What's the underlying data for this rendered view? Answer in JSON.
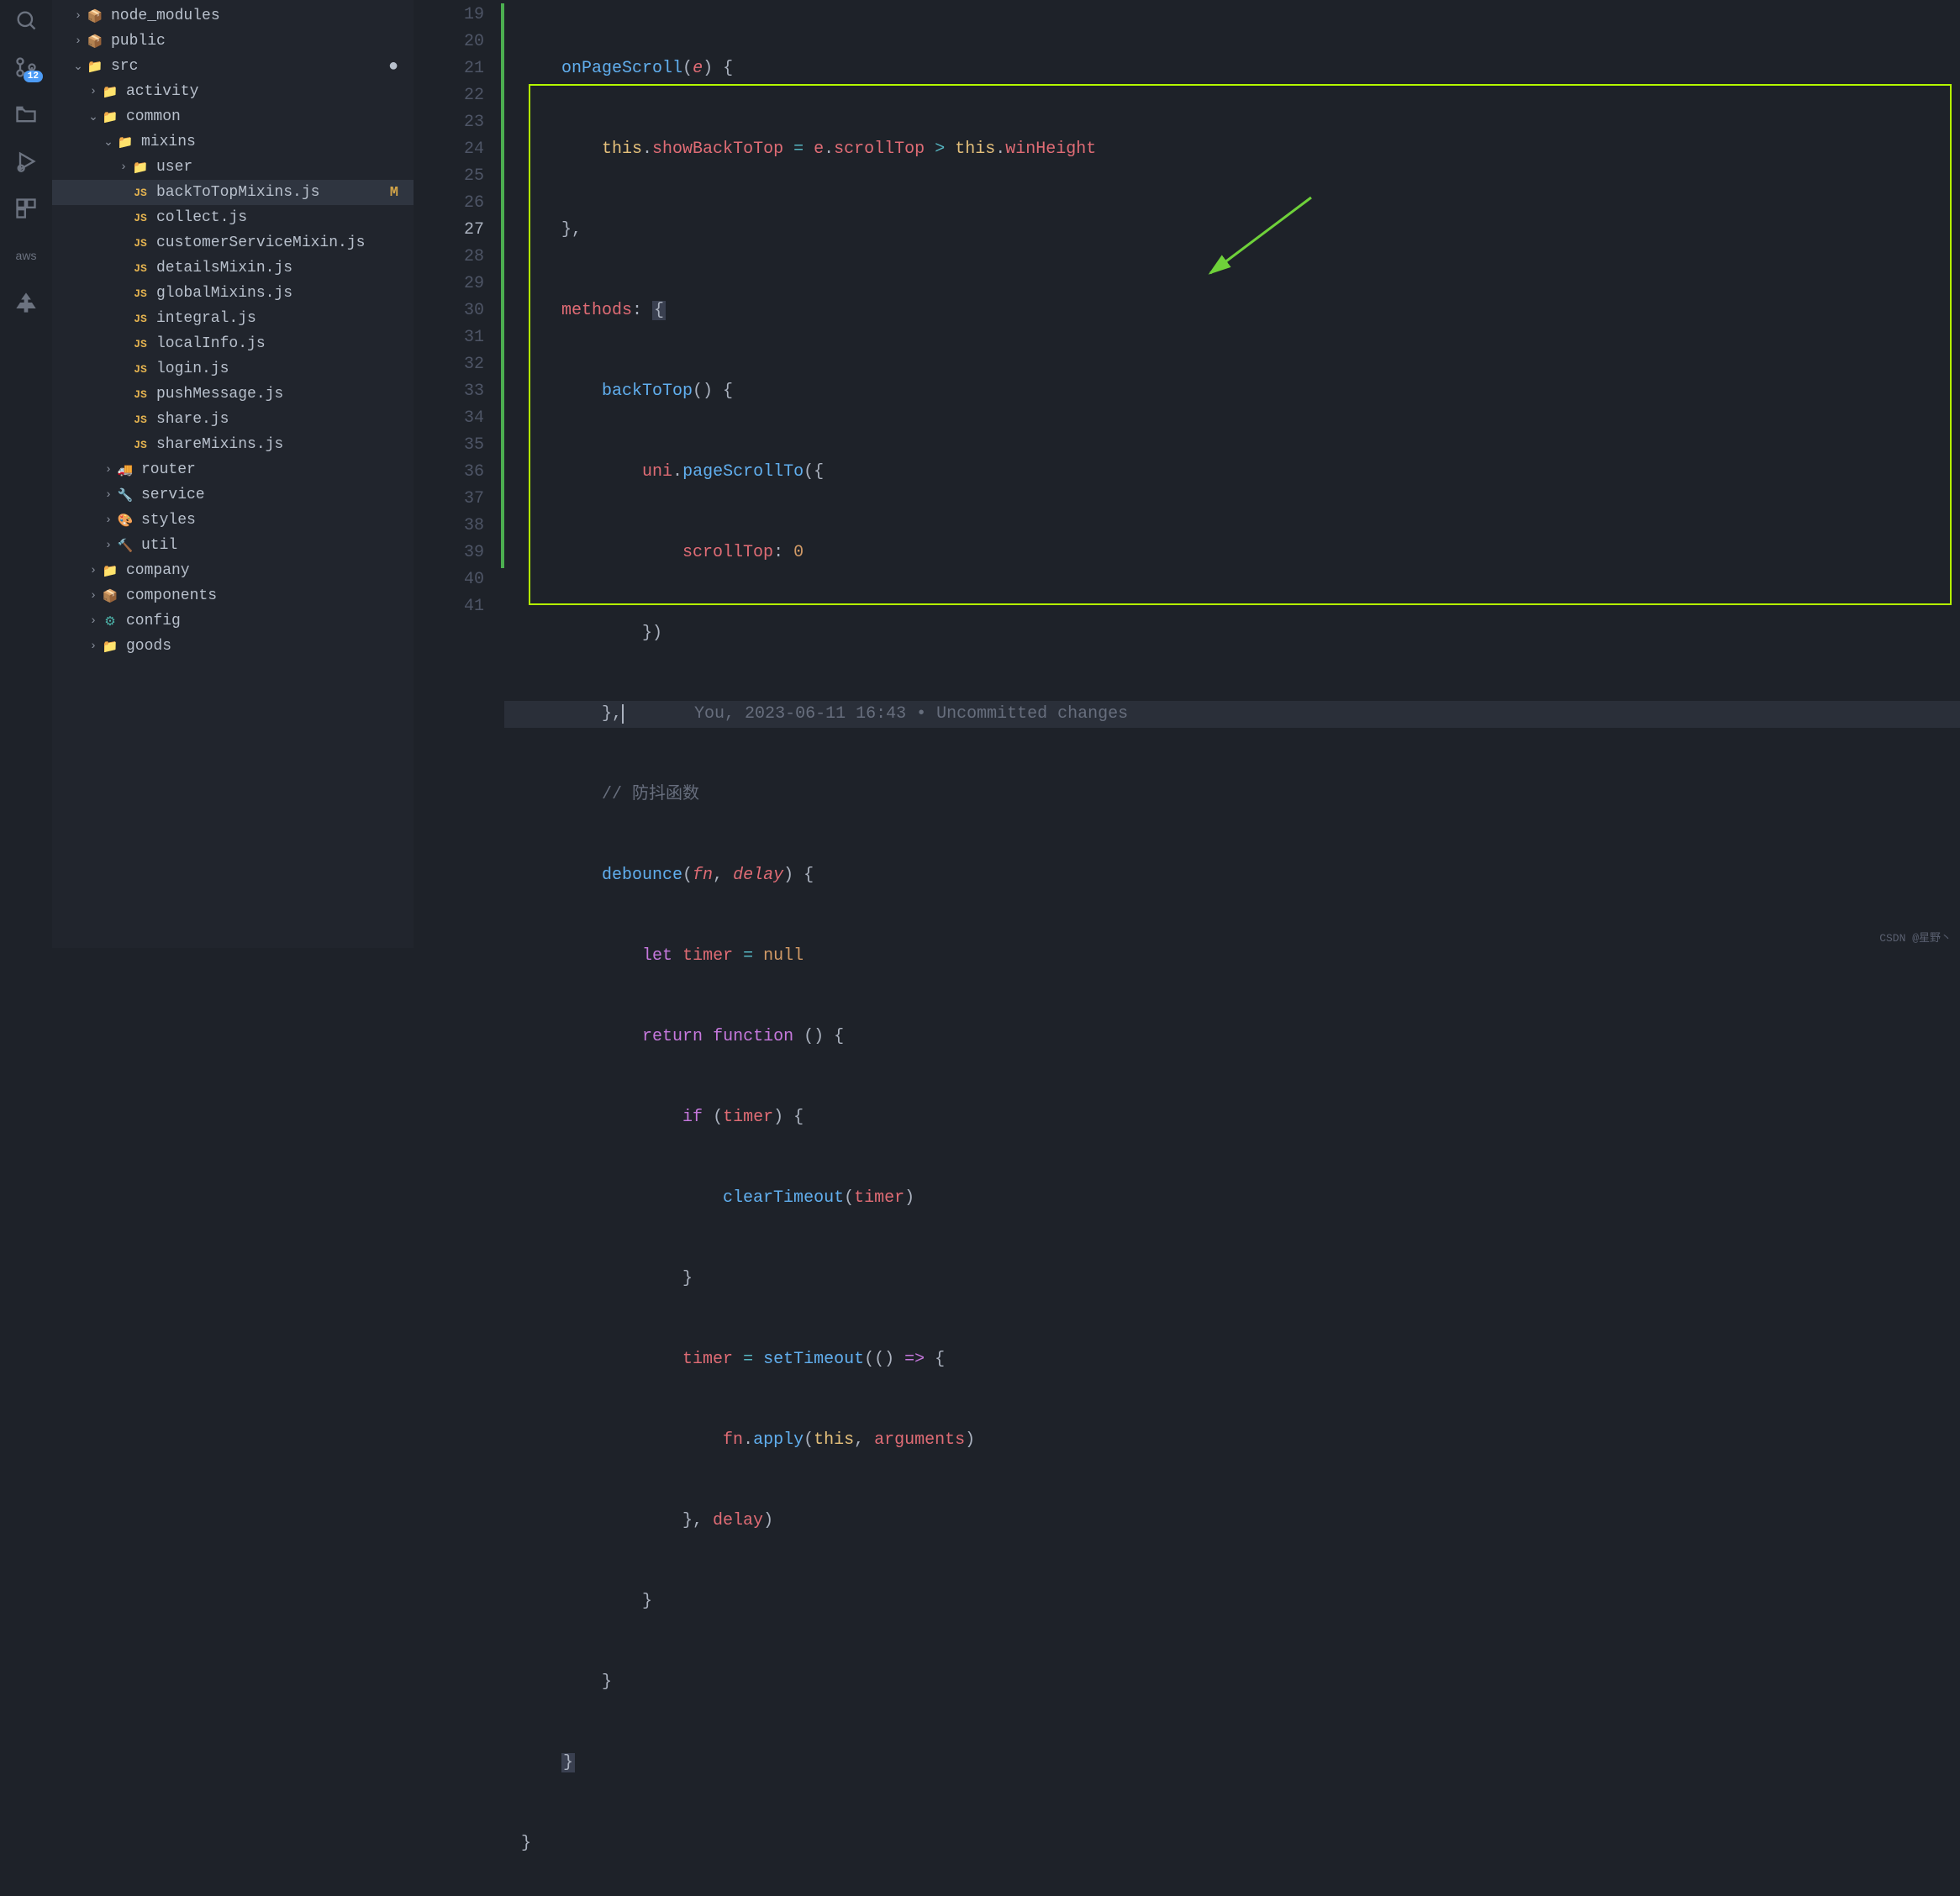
{
  "activity": {
    "scm_badge": "12",
    "aws_label": "aws"
  },
  "tree": [
    {
      "indent": 1,
      "chev": "›",
      "icon": "📦",
      "cls": "folder-green",
      "label": "node_modules"
    },
    {
      "indent": 1,
      "chev": "›",
      "icon": "📦",
      "cls": "folder-green",
      "label": "public"
    },
    {
      "indent": 1,
      "chev": "⌄",
      "icon": "📁",
      "cls": "folder-green",
      "label": "src",
      "dot": true
    },
    {
      "indent": 2,
      "chev": "›",
      "icon": "📁",
      "cls": "folder-yellow",
      "label": "activity"
    },
    {
      "indent": 2,
      "chev": "⌄",
      "icon": "📁",
      "cls": "folder-gray",
      "label": "common"
    },
    {
      "indent": 3,
      "chev": "⌄",
      "icon": "📁",
      "cls": "folder-yellow",
      "label": "mixins"
    },
    {
      "indent": 4,
      "chev": "›",
      "icon": "📁",
      "cls": "folder-yellow",
      "label": "user"
    },
    {
      "indent": 4,
      "chev": "",
      "icon": "JS",
      "cls": "js-icon",
      "label": "backToTopMixins.js",
      "selected": true,
      "gitM": "M"
    },
    {
      "indent": 4,
      "chev": "",
      "icon": "JS",
      "cls": "js-icon",
      "label": "collect.js"
    },
    {
      "indent": 4,
      "chev": "",
      "icon": "JS",
      "cls": "js-icon",
      "label": "customerServiceMixin.js"
    },
    {
      "indent": 4,
      "chev": "",
      "icon": "JS",
      "cls": "js-icon",
      "label": "detailsMixin.js"
    },
    {
      "indent": 4,
      "chev": "",
      "icon": "JS",
      "cls": "js-icon",
      "label": "globalMixins.js"
    },
    {
      "indent": 4,
      "chev": "",
      "icon": "JS",
      "cls": "js-icon",
      "label": "integral.js"
    },
    {
      "indent": 4,
      "chev": "",
      "icon": "JS",
      "cls": "js-icon",
      "label": "localInfo.js"
    },
    {
      "indent": 4,
      "chev": "",
      "icon": "JS",
      "cls": "js-icon",
      "label": "login.js"
    },
    {
      "indent": 4,
      "chev": "",
      "icon": "JS",
      "cls": "js-icon",
      "label": "pushMessage.js"
    },
    {
      "indent": 4,
      "chev": "",
      "icon": "JS",
      "cls": "js-icon",
      "label": "share.js"
    },
    {
      "indent": 4,
      "chev": "",
      "icon": "JS",
      "cls": "js-icon",
      "label": "shareMixins.js"
    },
    {
      "indent": 3,
      "chev": "›",
      "icon": "🚚",
      "cls": "folder-green",
      "label": "router"
    },
    {
      "indent": 3,
      "chev": "›",
      "icon": "🔧",
      "cls": "folder-teal",
      "label": "service"
    },
    {
      "indent": 3,
      "chev": "›",
      "icon": "🎨",
      "cls": "folder-blue",
      "label": "styles"
    },
    {
      "indent": 3,
      "chev": "›",
      "icon": "🔨",
      "cls": "folder-orange",
      "label": "util"
    },
    {
      "indent": 2,
      "chev": "›",
      "icon": "📁",
      "cls": "folder-yellow",
      "label": "company"
    },
    {
      "indent": 2,
      "chev": "›",
      "icon": "📦",
      "cls": "folder-orange",
      "label": "components"
    },
    {
      "indent": 2,
      "chev": "›",
      "icon": "⚙",
      "cls": "folder-teal",
      "label": "config"
    },
    {
      "indent": 2,
      "chev": "›",
      "icon": "📁",
      "cls": "folder-yellow",
      "label": "goods"
    }
  ],
  "gutter_start": 19,
  "gutter_end": 41,
  "active_line": 27,
  "blame": "You, 2023-06-11 16:43 • Uncommitted changes",
  "watermark": "CSDN @星野丶",
  "code": {
    "l19": {
      "fn": "onPageScroll",
      "p": "e"
    },
    "l20": {
      "this": "this",
      "prop1": "showBackToTop",
      "var": "e",
      "prop2": "scrollTop",
      "this2": "this",
      "prop3": "winHeight"
    },
    "l22": {
      "key": "methods"
    },
    "l23": {
      "fn": "backToTop"
    },
    "l24": {
      "obj": "uni",
      "fn": "pageScrollTo"
    },
    "l25": {
      "key": "scrollTop",
      "val": "0"
    },
    "l28": {
      "comment": "// 防抖函数"
    },
    "l29": {
      "fn": "debounce",
      "p1": "fn",
      "p2": "delay"
    },
    "l30": {
      "kw": "let",
      "var": "timer",
      "val": "null"
    },
    "l31": {
      "kw": "return",
      "kw2": "function"
    },
    "l32": {
      "kw": "if",
      "var": "timer"
    },
    "l33": {
      "fn": "clearTimeout",
      "var": "timer"
    },
    "l35": {
      "var": "timer",
      "fn": "setTimeout"
    },
    "l36": {
      "var": "fn",
      "fn": "apply",
      "this": "this",
      "arg": "arguments"
    },
    "l37": {
      "var": "delay"
    }
  }
}
